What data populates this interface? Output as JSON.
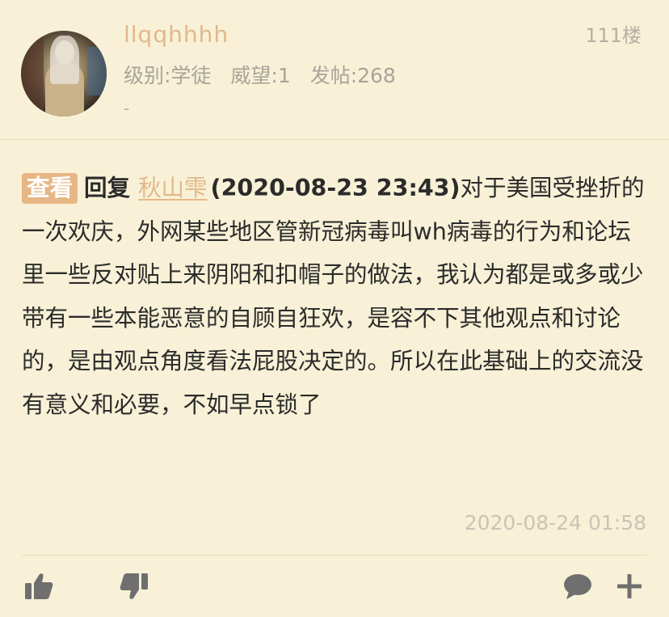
{
  "post": {
    "username": "llqqhhhh",
    "floor": "111楼",
    "level": "级别:学徒",
    "prestige": "威望:1",
    "posts": "发帖:268",
    "signature": "-",
    "tag": "查看",
    "reply_label": "回复",
    "reply_to": "秋山雫",
    "quote_time": "(2020-08-23 23:43)",
    "body": "对于美国受挫折的一次欢庆，外网某些地区管新冠病毒叫wh病毒的行为和论坛里一些反对贴上来阴阳和扣帽子的做法，我认为都是或多或少带有一些本能恶意的自顾自狂欢，是容不下其他观点和讨论的，是由观点角度看法屁股决定的。所以在此基础上的交流没有意义和必要，不如早点锁了",
    "post_time": "2020-08-24 01:58"
  },
  "icons": [
    "thumbs-up-icon",
    "thumbs-down-icon",
    "comment-icon",
    "plus-icon"
  ],
  "colors": {
    "accent": "#e2b88a",
    "tag_bg": "#e7b685",
    "background": "#f8f1d7"
  }
}
